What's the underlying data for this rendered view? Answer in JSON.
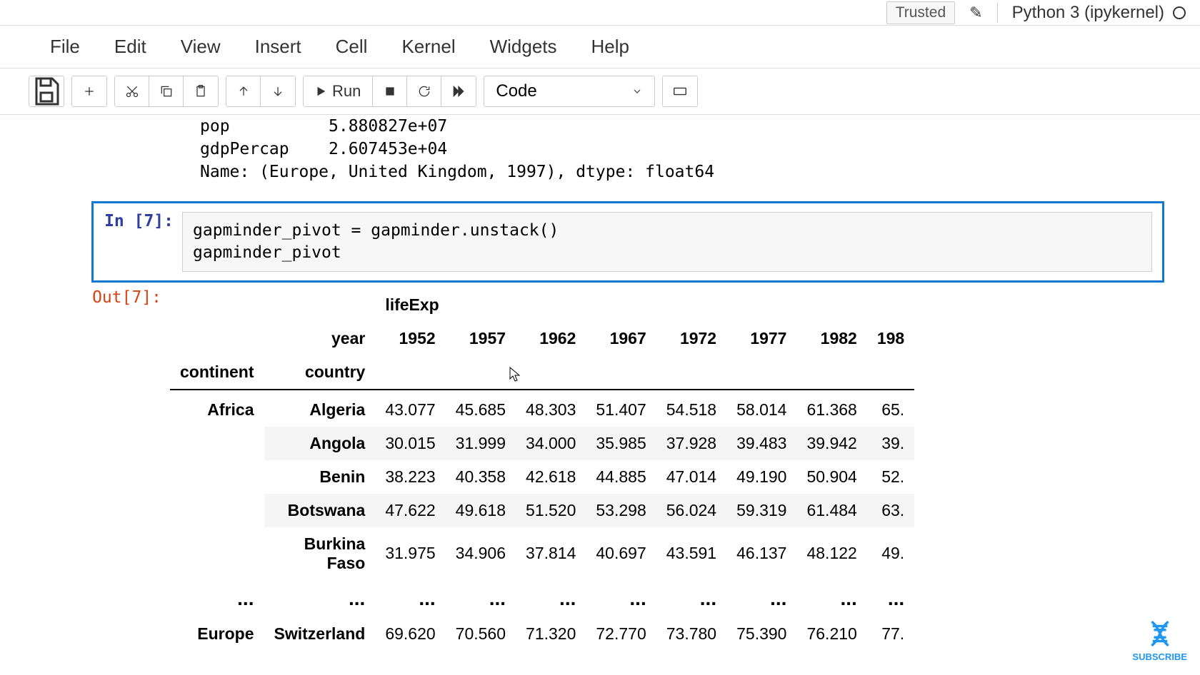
{
  "header": {
    "trusted": "Trusted",
    "kernel": "Python 3 (ipykernel)"
  },
  "menu": {
    "file": "File",
    "edit": "Edit",
    "view": "View",
    "insert": "Insert",
    "cell": "Cell",
    "kernel": "Kernel",
    "widgets": "Widgets",
    "help": "Help"
  },
  "toolbar": {
    "run": "Run",
    "celltype": "Code"
  },
  "prev_output": "pop          5.880827e+07\ngdpPercap    2.607453e+04\nName: (Europe, United Kingdom, 1997), dtype: float64",
  "cell": {
    "in_prompt": "In [7]:",
    "code": "gapminder_pivot = gapminder.unstack()\ngapminder_pivot",
    "out_prompt": "Out[7]:"
  },
  "table": {
    "top_header": "lifeExp",
    "year_label": "year",
    "continent_label": "continent",
    "country_label": "country",
    "years": [
      "1952",
      "1957",
      "1962",
      "1967",
      "1972",
      "1977",
      "1982",
      "198"
    ],
    "rows": [
      {
        "continent": "Africa",
        "country": "Algeria",
        "vals": [
          "43.077",
          "45.685",
          "48.303",
          "51.407",
          "54.518",
          "58.014",
          "61.368",
          "65."
        ]
      },
      {
        "continent": "",
        "country": "Angola",
        "vals": [
          "30.015",
          "31.999",
          "34.000",
          "35.985",
          "37.928",
          "39.483",
          "39.942",
          "39."
        ]
      },
      {
        "continent": "",
        "country": "Benin",
        "vals": [
          "38.223",
          "40.358",
          "42.618",
          "44.885",
          "47.014",
          "49.190",
          "50.904",
          "52."
        ]
      },
      {
        "continent": "",
        "country": "Botswana",
        "vals": [
          "47.622",
          "49.618",
          "51.520",
          "53.298",
          "56.024",
          "59.319",
          "61.484",
          "63."
        ]
      },
      {
        "continent": "",
        "country": "Burkina Faso",
        "vals": [
          "31.975",
          "34.906",
          "37.814",
          "40.697",
          "43.591",
          "46.137",
          "48.122",
          "49."
        ]
      }
    ],
    "ellipsis": "...",
    "europe_row": {
      "continent": "Europe",
      "country": "Switzerland",
      "vals": [
        "69.620",
        "70.560",
        "71.320",
        "72.770",
        "73.780",
        "75.390",
        "76.210",
        "77."
      ]
    }
  },
  "subscribe": "SUBSCRIBE"
}
